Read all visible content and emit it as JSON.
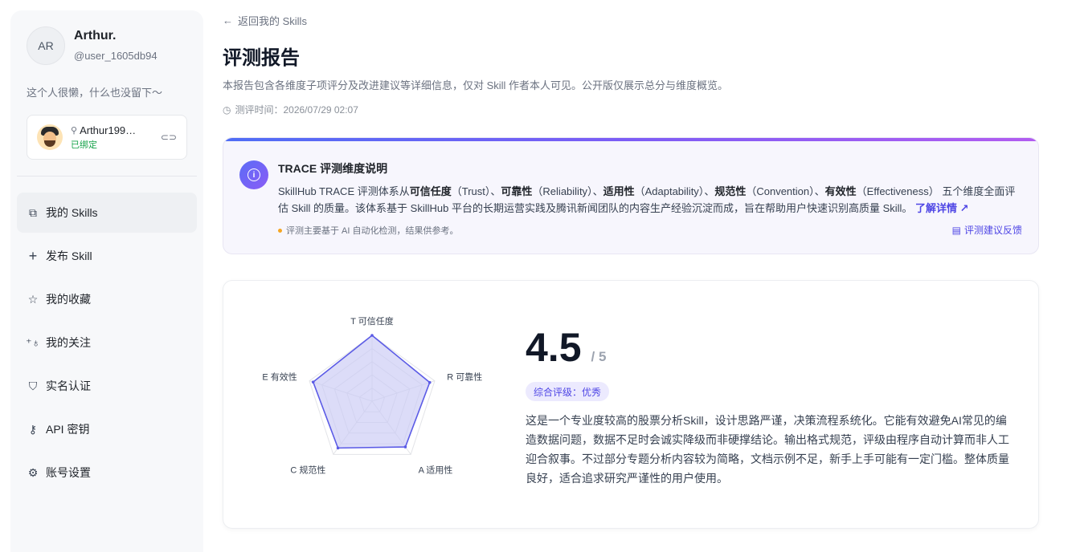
{
  "sidebar": {
    "avatar_initials": "AR",
    "display_name": "Arthur.",
    "handle": "@user_1605db94",
    "bio": "这个人很懒，什么也没留下～",
    "github": {
      "name": "Arthur199…",
      "status": "已绑定",
      "icon": "github-icon",
      "unlink_icon": "unlink-icon"
    },
    "nav": [
      {
        "label": "我的 Skills",
        "icon": "skills-icon",
        "active": true
      },
      {
        "label": "发布 Skill",
        "icon": "plus-icon"
      },
      {
        "label": "我的收藏",
        "icon": "star-icon"
      },
      {
        "label": "我的关注",
        "icon": "follow-icon"
      },
      {
        "label": "实名认证",
        "icon": "shield-icon"
      },
      {
        "label": "API 密钥",
        "icon": "key-icon"
      },
      {
        "label": "账号设置",
        "icon": "gear-icon"
      }
    ]
  },
  "header": {
    "back_label": "返回我的 Skills",
    "title": "评测报告",
    "subtitle": "本报告包含各维度子项评分及改进建议等详细信息，仅对 Skill 作者本人可见。公开版仅展示总分与维度概览。",
    "eval_time": "测评时间：2026/07/29 02:07"
  },
  "trace": {
    "title": "TRACE 评测维度说明",
    "desc_prefix": "SkillHub TRACE 评测体系从",
    "dims": [
      {
        "name": "可信任度",
        "en": "（Trust）"
      },
      {
        "name": "可靠性",
        "en": "（Reliability）"
      },
      {
        "name": "适用性",
        "en": "（Adaptability）"
      },
      {
        "name": "规范性",
        "en": "（Convention）"
      },
      {
        "name": "有效性",
        "en": "（Effectiveness）"
      }
    ],
    "sep": "、",
    "desc_suffix": " 五个维度全面评估 Skill 的质量。该体系基于 SkillHub 平台的长期运营实践及腾讯新闻团队的内容生产经验沉淀而成，旨在帮助用户快速识别高质量 Skill。",
    "learn_more": "了解详情 ↗",
    "note": "评测主要基于 AI 自动化检测，结果供参考。",
    "feedback": "评测建议反馈"
  },
  "report": {
    "score": "4.5",
    "score_max": "/ 5",
    "grade": "综合评级：优秀",
    "summary": "这是一个专业度较高的股票分析Skill，设计思路严谨，决策流程系统化。它能有效避免AI常见的编造数据问题，数据不足时会诚实降级而非硬撑结论。输出格式规范，评级由程序自动计算而非人工迎合叙事。不过部分专题分析内容较为简略，文档示例不足，新手上手可能有一定门槛。整体质量良好，适合追求研究严谨性的用户使用。"
  },
  "chart_data": {
    "type": "radar",
    "axes": [
      "T 可信任度",
      "R 可靠性",
      "A 适用性",
      "C 规范性",
      "E 有效性"
    ],
    "values": [
      5,
      4.6,
      4.3,
      4.4,
      4.7
    ],
    "range": [
      0,
      5
    ],
    "rings": 5,
    "colors": {
      "fill": "#c9caf5",
      "stroke": "#5b5be6",
      "grid": "#e3e4e8"
    }
  }
}
